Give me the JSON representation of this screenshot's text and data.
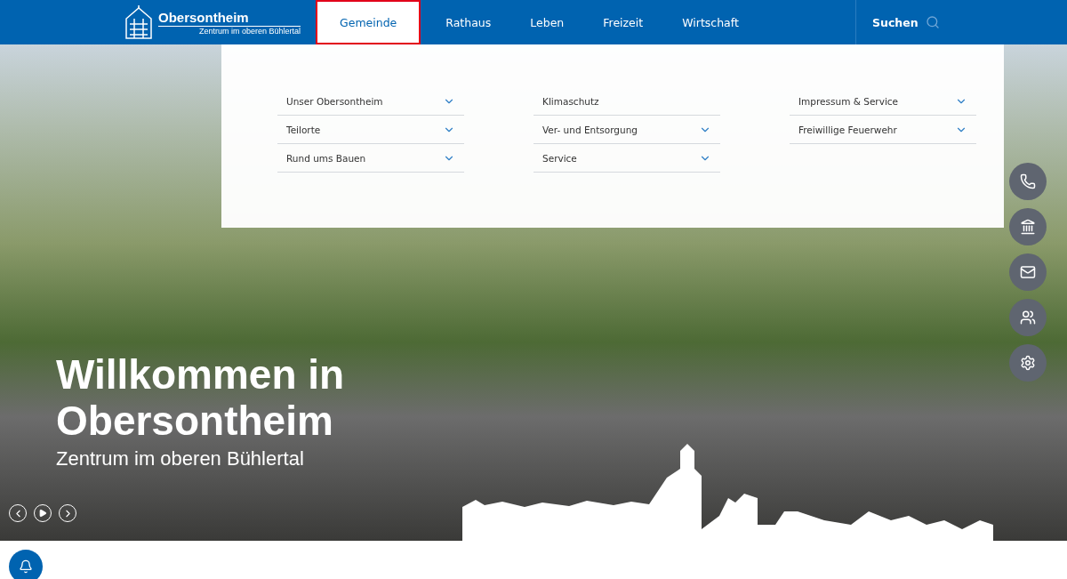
{
  "header": {
    "logo": {
      "name": "Obersontheim",
      "tagline": "Zentrum im oberen Bühlertal"
    },
    "nav": [
      {
        "label": "Gemeinde",
        "selected": true
      },
      {
        "label": "Rathaus",
        "selected": false
      },
      {
        "label": "Leben",
        "selected": false
      },
      {
        "label": "Freizeit",
        "selected": false
      },
      {
        "label": "Wirtschaft",
        "selected": false
      }
    ],
    "search": "Suchen"
  },
  "mega_menu": {
    "columns": [
      [
        {
          "label": "Unser Obersontheim",
          "expandable": true
        },
        {
          "label": "Teilorte",
          "expandable": true
        },
        {
          "label": "Rund ums Bauen",
          "expandable": true
        }
      ],
      [
        {
          "label": "Klimaschutz",
          "expandable": false
        },
        {
          "label": "Ver- und Entsorgung",
          "expandable": true
        },
        {
          "label": "Service",
          "expandable": true
        }
      ],
      [
        {
          "label": "Impressum & Service",
          "expandable": true
        },
        {
          "label": "Freiwillige Feuerwehr",
          "expandable": true
        }
      ]
    ]
  },
  "hero": {
    "title": "Willkommen in Obersontheim",
    "subtitle": "Zentrum im oberen Bühlertal"
  },
  "side_buttons": [
    {
      "kind": "phone"
    },
    {
      "kind": "building"
    },
    {
      "kind": "mail"
    },
    {
      "kind": "people"
    },
    {
      "kind": "settings"
    }
  ]
}
